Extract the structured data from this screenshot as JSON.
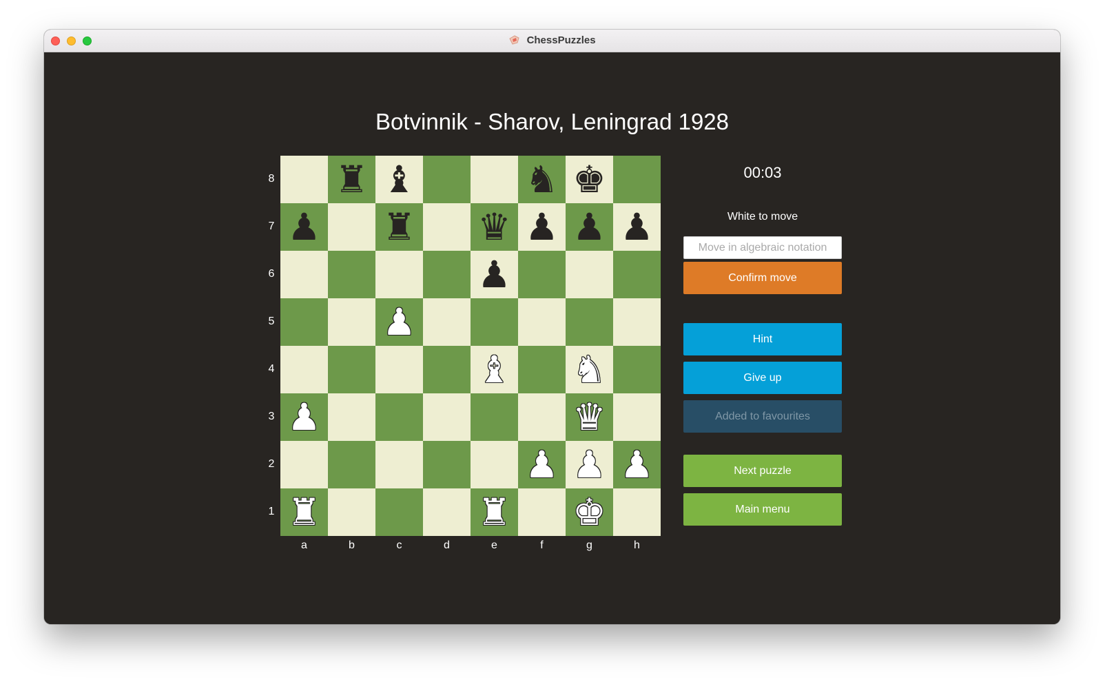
{
  "window": {
    "title": "ChessPuzzles"
  },
  "puzzle": {
    "title": "Botvinnik - Sharov, Leningrad 1928",
    "timer": "00:03",
    "turn": "White to move"
  },
  "controls": {
    "move_placeholder": "Move in algebraic notation",
    "confirm_label": "Confirm move",
    "hint_label": "Hint",
    "give_up_label": "Give up",
    "favourites_label": "Added to favourites",
    "next_label": "Next puzzle",
    "main_menu_label": "Main menu"
  },
  "colors": {
    "board_light": "#eeeed2",
    "board_dark": "#6d994a",
    "confirm": "#de7b27",
    "hint": "#05a0d8",
    "favourites": "#284e66",
    "next": "#7db442",
    "background": "#282522"
  },
  "board": {
    "ranks": [
      "8",
      "7",
      "6",
      "5",
      "4",
      "3",
      "2",
      "1"
    ],
    "files": [
      "a",
      "b",
      "c",
      "d",
      "e",
      "f",
      "g",
      "h"
    ],
    "position": [
      [
        "",
        "r",
        "b",
        "",
        "",
        "n",
        "k",
        ""
      ],
      [
        "p",
        "",
        "r",
        "",
        "q",
        "p",
        "p",
        "p"
      ],
      [
        "",
        "",
        "",
        "",
        "p",
        "",
        "",
        ""
      ],
      [
        "",
        "",
        "P",
        "",
        "",
        "",
        "",
        ""
      ],
      [
        "",
        "",
        "",
        "",
        "B",
        "",
        "N",
        ""
      ],
      [
        "P",
        "",
        "",
        "",
        "",
        "",
        "Q",
        ""
      ],
      [
        "",
        "",
        "",
        "",
        "",
        "P",
        "P",
        "P"
      ],
      [
        "R",
        "",
        "",
        "",
        "R",
        "",
        "K",
        ""
      ]
    ]
  }
}
